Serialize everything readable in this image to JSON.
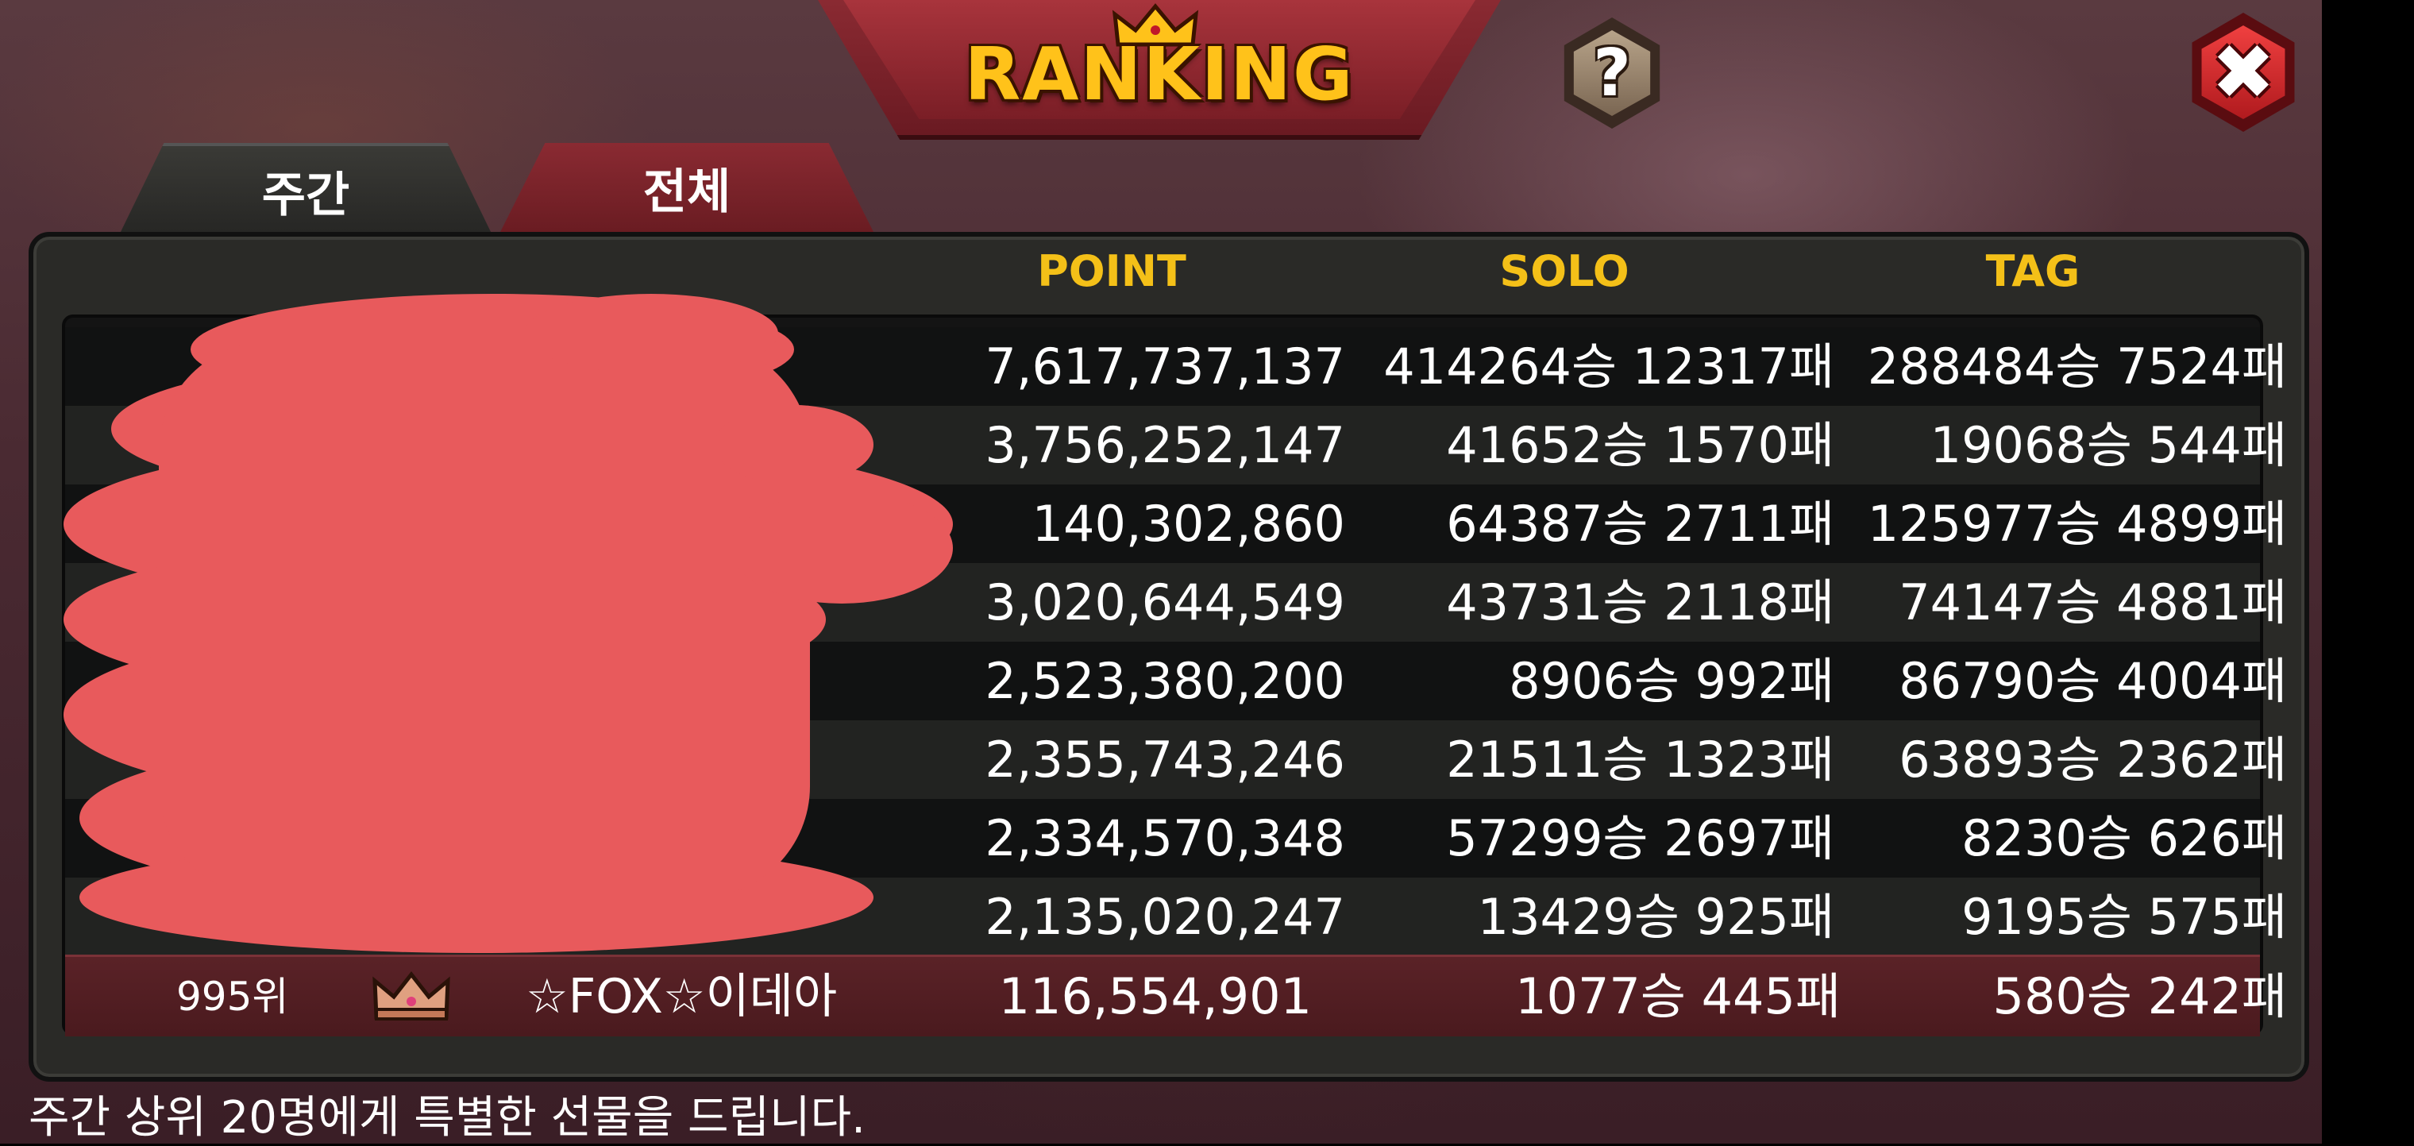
{
  "title": "RANKING",
  "tabs": [
    {
      "label": "주간",
      "active": true
    },
    {
      "label": "전체",
      "active": false
    }
  ],
  "buttons": {
    "help_icon": "?",
    "close_icon": "✖"
  },
  "columns": {
    "point": "POINT",
    "solo": "SOLO",
    "tag": "TAG"
  },
  "rows": [
    {
      "point": "7,617,737,137",
      "solo": "414264승 12317패",
      "tag": "288484승 7524패"
    },
    {
      "point": "3,756,252,147",
      "solo": "41652승 1570패",
      "tag": "19068승 544패"
    },
    {
      "point": "140,302,860",
      "solo": "64387승 2711패",
      "tag": "125977승 4899패"
    },
    {
      "point": "3,020,644,549",
      "solo": "43731승 2118패",
      "tag": "74147승 4881패"
    },
    {
      "point": "2,523,380,200",
      "solo": "8906승 992패",
      "tag": "86790승 4004패"
    },
    {
      "point": "2,355,743,246",
      "solo": "21511승 1323패",
      "tag": "63893승 2362패"
    },
    {
      "point": "2,334,570,348",
      "solo": "57299승 2697패",
      "tag": "8230승 626패"
    },
    {
      "point": "2,135,020,247",
      "solo": "13429승 925패",
      "tag": "9195승 575패"
    }
  ],
  "my_rank": {
    "rank": "995위",
    "name": "☆FOX☆이데아",
    "point": "116,554,901",
    "solo": "1077승 445패",
    "tag": "580승 242패"
  },
  "footer": "주간 상위 20명에게 특별한 선물을 드립니다.",
  "colors": {
    "accent_gold": "#f4c018",
    "banner_red": "#8a2a32",
    "redaction": "#e85a5c"
  }
}
